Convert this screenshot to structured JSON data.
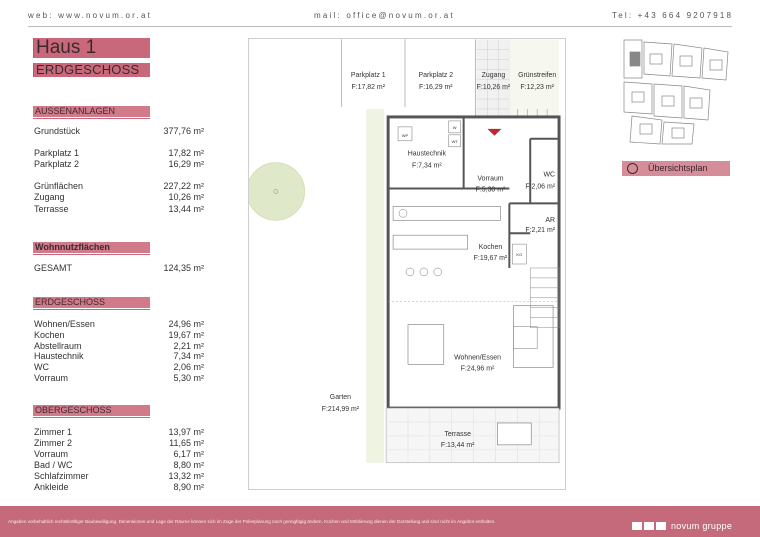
{
  "header": {
    "web": "web: www.novum.or.at",
    "mail": "mail: office@novum.or.at",
    "tel": "Tel: +43 664 9207918"
  },
  "title": {
    "main": "Haus 1",
    "sub": "ERDGESCHOSS"
  },
  "aussen": {
    "heading": "AUSSENANLAGEN",
    "rows": [
      {
        "label": "Grundstück",
        "value": "377,76 m²"
      },
      {
        "label": "Parkplatz 1",
        "value": "17,82 m²"
      },
      {
        "label": "Parkplatz 2",
        "value": "16,29 m²"
      },
      {
        "label": "Grünflächen",
        "value": "227,22 m²"
      },
      {
        "label": "Zugang",
        "value": "10,26 m²"
      },
      {
        "label": "Terrasse",
        "value": "13,44 m²"
      }
    ]
  },
  "wohn": {
    "heading": "Wohnnutzflächen",
    "rows": [
      {
        "label": "GESAMT",
        "value": "124,35 m²"
      }
    ]
  },
  "eg": {
    "heading": "ERDGESCHOSS",
    "rows": [
      {
        "label": "Wohnen/Essen",
        "value": "24,96 m²"
      },
      {
        "label": "Kochen",
        "value": "19,67 m²"
      },
      {
        "label": "Abstellraum",
        "value": "2,21 m²"
      },
      {
        "label": "Haustechnik",
        "value": "7,34 m²"
      },
      {
        "label": "WC",
        "value": "2,06 m²"
      },
      {
        "label": "Vorraum",
        "value": "5,30 m²"
      }
    ]
  },
  "og": {
    "heading": "OBERGESCHOSS",
    "rows": [
      {
        "label": "Zimmer 1",
        "value": "13,97 m²"
      },
      {
        "label": "Zimmer 2",
        "value": "11,65 m²"
      },
      {
        "label": "Vorraum",
        "value": "6,17 m²"
      },
      {
        "label": "Bad / WC",
        "value": "8,80 m²"
      },
      {
        "label": "Schlafzimmer",
        "value": "13,32 m²"
      },
      {
        "label": "Ankleide",
        "value": "8,90 m²"
      }
    ]
  },
  "plan": {
    "parkplatz1": {
      "name": "Parkplatz 1",
      "area": "F:17,82 m²"
    },
    "parkplatz2": {
      "name": "Parkplatz 2",
      "area": "F:16,29 m²"
    },
    "zugang": {
      "name": "Zugang",
      "area": "F:10,26 m²"
    },
    "gruen": {
      "name": "Grünstreifen",
      "area": "F:12,23 m²"
    },
    "haustechnik": {
      "name": "Haustechnik",
      "area": "F:7,34 m²"
    },
    "vorraum": {
      "name": "Vorraum",
      "area": "F:5,30 m²"
    },
    "wc": {
      "name": "WC",
      "area": "F:2,06 m²"
    },
    "ar": {
      "name": "AR",
      "area": "F:2,21 m²"
    },
    "kochen": {
      "name": "Kochen",
      "area": "F:19,67 m²"
    },
    "wohnen": {
      "name": "Wohnen/Essen",
      "area": "F:24,96 m²"
    },
    "garten": {
      "name": "Garten",
      "area": "F:214,99 m²"
    },
    "terrasse": {
      "name": "Terrasse",
      "area": "F:13,44 m²"
    },
    "wp": "WP",
    "w": "W",
    "wt": "WT",
    "kg": "KG"
  },
  "overview_label": "Übersichtsplan",
  "footer": {
    "disclaimer": "Angaben vorbehaltlich rechtskräftiger Baubewilligung. Dimensionen und Lage der Räume können sich im Zuge der Polierplanung noch geringfügig ändern. Küchen und Möblierung dienen der Darstellung und sind nicht im Angebot enthalten.",
    "brand": "novum gruppe"
  },
  "colors": {
    "accent": "#c9687a",
    "footer": "#c46a7a",
    "garden_circle": "#dfe8c8"
  }
}
